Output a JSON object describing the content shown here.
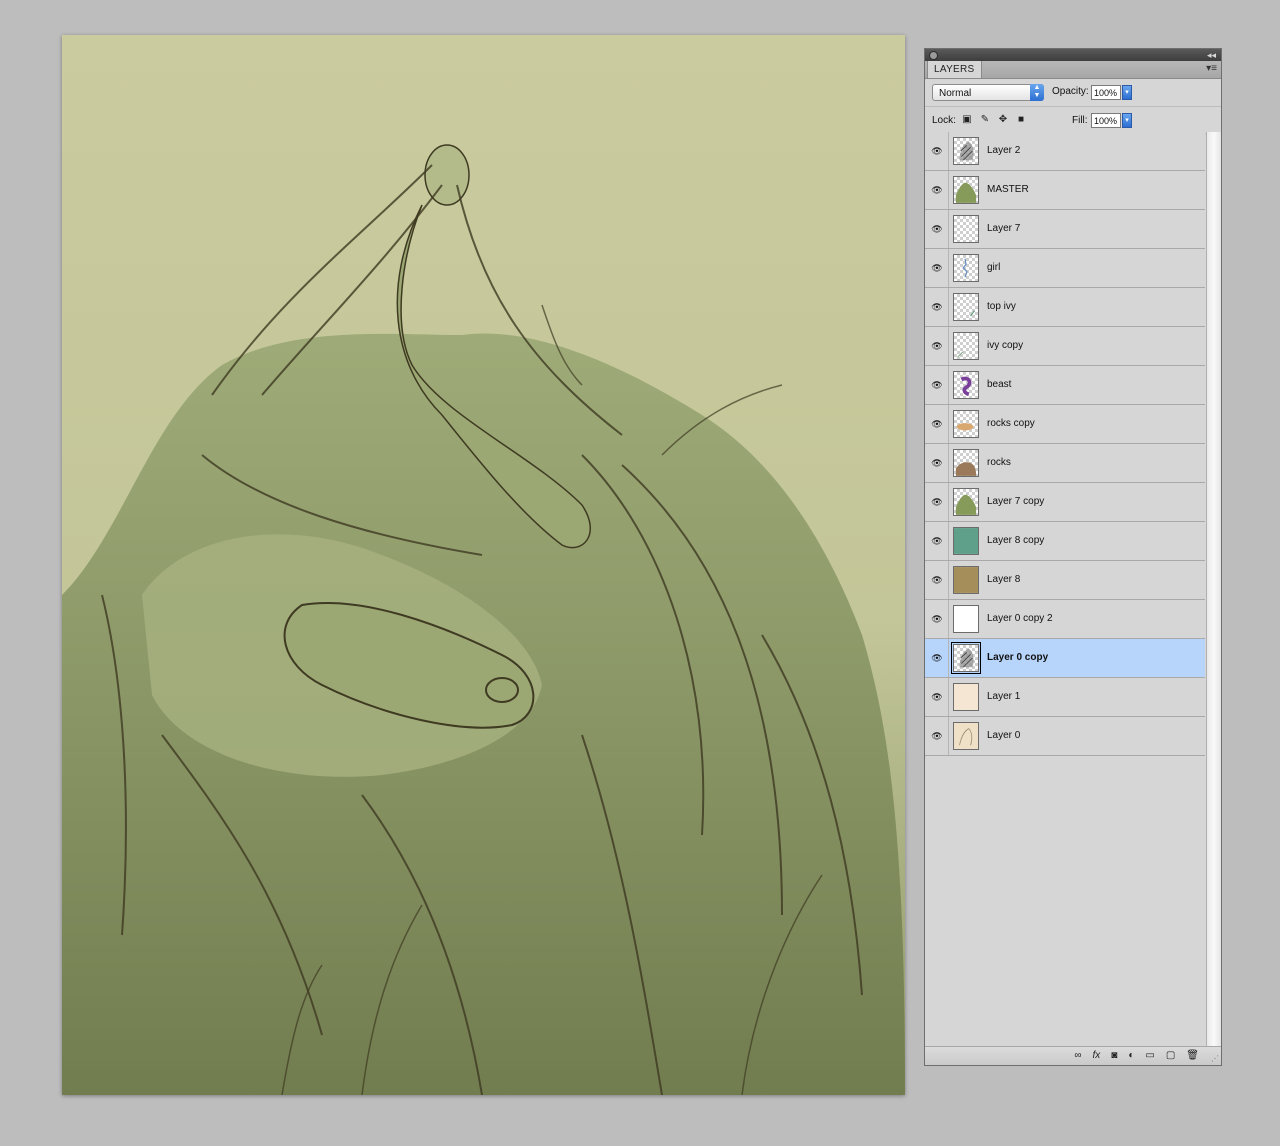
{
  "panel": {
    "tab_label": "LAYERS",
    "blend_mode": "Normal",
    "opacity_label": "Opacity:",
    "opacity_value": "100%",
    "lock_label": "Lock:",
    "fill_label": "Fill:",
    "fill_value": "100%",
    "lock_icons": [
      "transparency-lock-icon",
      "brush-lock-icon",
      "move-lock-icon",
      "padlock-icon"
    ],
    "layers": [
      {
        "name": "Layer 2",
        "thumb": "sketch",
        "selected": false
      },
      {
        "name": "MASTER",
        "thumb": "green-mound",
        "selected": false
      },
      {
        "name": "Layer 7",
        "thumb": "transparent",
        "selected": false
      },
      {
        "name": "girl",
        "thumb": "blue-figure",
        "selected": false
      },
      {
        "name": "top ivy",
        "thumb": "ivy-top",
        "selected": false
      },
      {
        "name": "ivy copy",
        "thumb": "ivy-bottom",
        "selected": false
      },
      {
        "name": "beast",
        "thumb": "purple-beast",
        "selected": false
      },
      {
        "name": "rocks copy",
        "thumb": "tan-blob",
        "selected": false
      },
      {
        "name": "rocks",
        "thumb": "brown-mound",
        "selected": false
      },
      {
        "name": "Layer 7 copy",
        "thumb": "green-mound",
        "selected": false
      },
      {
        "name": "Layer 8 copy",
        "thumb": "teal-fill",
        "selected": false
      },
      {
        "name": "Layer 8",
        "thumb": "ochre-fill",
        "selected": false
      },
      {
        "name": "Layer 0 copy 2",
        "thumb": "white-fill",
        "selected": false
      },
      {
        "name": "Layer 0 copy",
        "thumb": "sketch",
        "selected": true
      },
      {
        "name": "Layer 1",
        "thumb": "cream-fill",
        "selected": false
      },
      {
        "name": "Layer 0",
        "thumb": "cream-sketch",
        "selected": false
      }
    ],
    "bottom_icons": [
      "link-layers-icon",
      "fx-icon",
      "layer-mask-icon",
      "adjustment-layer-icon",
      "new-group-icon",
      "new-layer-icon",
      "trash-icon"
    ],
    "colors": {
      "selected_row": "#b7d4fb",
      "panel_bg": "#d6d6d6"
    }
  },
  "canvas": {
    "artwork": "illustration-green-monochrome",
    "colors": {
      "background": "#c9c99d",
      "ink": "#3f3a22",
      "mid": "#8f9a6a"
    }
  }
}
